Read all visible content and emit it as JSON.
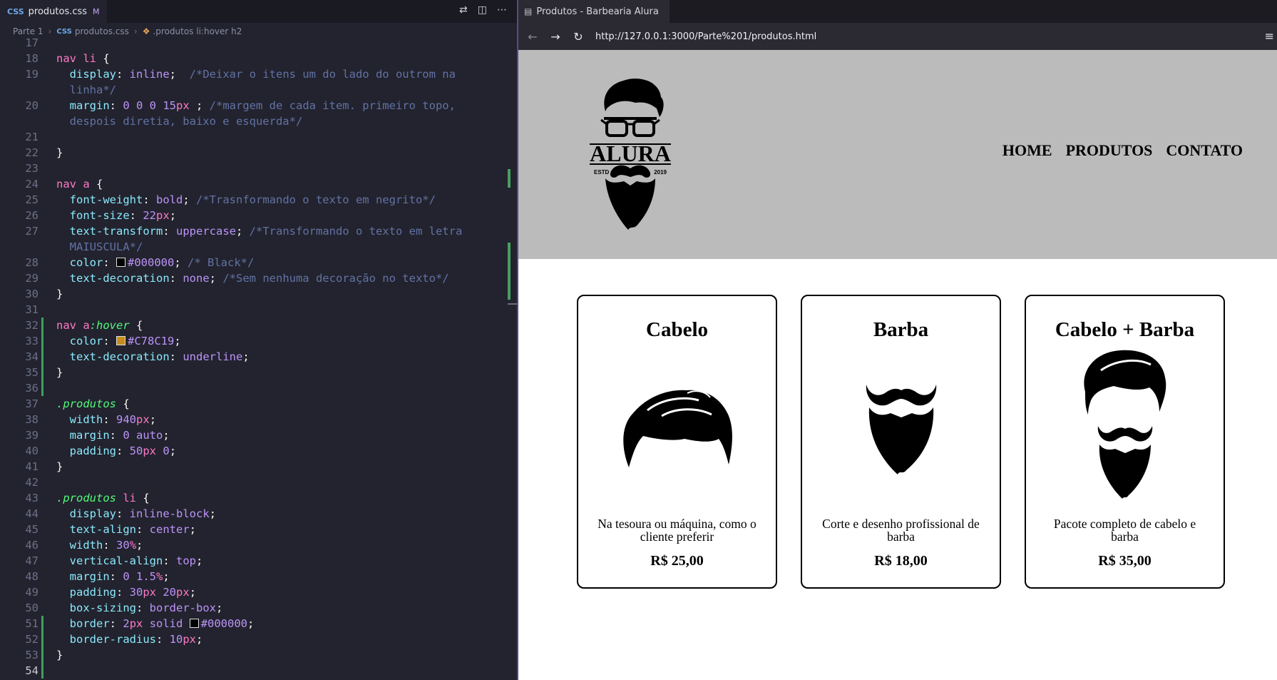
{
  "editor": {
    "tab": {
      "label": "produtos.css",
      "status": "M"
    },
    "breadcrumb": [
      "Parte 1",
      "produtos.css",
      ".produtos li:hover h2"
    ],
    "lines": [
      {
        "n": "17",
        "code": []
      },
      {
        "n": "18",
        "code": [
          [
            "sel",
            "nav li"
          ],
          [
            "p",
            " {"
          ]
        ]
      },
      {
        "n": "19",
        "code": [
          [
            "p",
            "  "
          ],
          [
            "prop",
            "display"
          ],
          [
            "p",
            ": "
          ],
          [
            "val",
            "inline"
          ],
          [
            "p",
            ";  "
          ],
          [
            "com",
            "/*Deixar o itens um do lado do outrom na"
          ]
        ]
      },
      {
        "n": "",
        "code": [
          [
            "p",
            "  "
          ],
          [
            "com",
            "linha*/"
          ]
        ]
      },
      {
        "n": "20",
        "code": [
          [
            "p",
            "  "
          ],
          [
            "prop",
            "margin"
          ],
          [
            "p",
            ": "
          ],
          [
            "num",
            "0 0 0 15"
          ],
          [
            "unit",
            "px"
          ],
          [
            "p",
            " ; "
          ],
          [
            "com",
            "/*margem de cada item. primeiro topo,"
          ]
        ]
      },
      {
        "n": "",
        "code": [
          [
            "p",
            "  "
          ],
          [
            "com",
            "despois diretia, baixo e esquerda*/"
          ]
        ]
      },
      {
        "n": "21",
        "code": []
      },
      {
        "n": "22",
        "code": [
          [
            "p",
            "}"
          ]
        ]
      },
      {
        "n": "23",
        "code": []
      },
      {
        "n": "24",
        "code": [
          [
            "sel",
            "nav a"
          ],
          [
            "p",
            " {"
          ]
        ]
      },
      {
        "n": "25",
        "code": [
          [
            "p",
            "  "
          ],
          [
            "prop",
            "font-weight"
          ],
          [
            "p",
            ": "
          ],
          [
            "val",
            "bold"
          ],
          [
            "p",
            "; "
          ],
          [
            "com",
            "/*Trasnformando o texto em negrito*/"
          ]
        ]
      },
      {
        "n": "26",
        "code": [
          [
            "p",
            "  "
          ],
          [
            "prop",
            "font-size"
          ],
          [
            "p",
            ": "
          ],
          [
            "num",
            "22"
          ],
          [
            "unit",
            "px"
          ],
          [
            "p",
            ";"
          ]
        ]
      },
      {
        "n": "27",
        "code": [
          [
            "p",
            "  "
          ],
          [
            "prop",
            "text-transform"
          ],
          [
            "p",
            ": "
          ],
          [
            "val",
            "uppercase"
          ],
          [
            "p",
            "; "
          ],
          [
            "com",
            "/*Transformando o texto em letra"
          ]
        ]
      },
      {
        "n": "",
        "code": [
          [
            "p",
            "  "
          ],
          [
            "com",
            "MAIUSCULA*/"
          ]
        ]
      },
      {
        "n": "28",
        "code": [
          [
            "p",
            "  "
          ],
          [
            "prop",
            "color"
          ],
          [
            "p",
            ": "
          ],
          [
            "swatch",
            "#000000"
          ],
          [
            "val",
            "#000000"
          ],
          [
            "p",
            "; "
          ],
          [
            "com",
            "/* Black*/"
          ]
        ]
      },
      {
        "n": "29",
        "code": [
          [
            "p",
            "  "
          ],
          [
            "prop",
            "text-decoration"
          ],
          [
            "p",
            ": "
          ],
          [
            "val",
            "none"
          ],
          [
            "p",
            "; "
          ],
          [
            "com",
            "/*Sem nenhuma decoração no texto*/"
          ]
        ]
      },
      {
        "n": "30",
        "code": [
          [
            "p",
            "}"
          ]
        ]
      },
      {
        "n": "31",
        "code": []
      },
      {
        "n": "32",
        "code": [
          [
            "sel",
            "nav a"
          ],
          [
            "pseudo",
            ":hover"
          ],
          [
            "p",
            " {"
          ]
        ]
      },
      {
        "n": "33",
        "code": [
          [
            "p",
            "  "
          ],
          [
            "prop",
            "color"
          ],
          [
            "p",
            ": "
          ],
          [
            "swatch",
            "#C78C19"
          ],
          [
            "val",
            "#C78C19"
          ],
          [
            "p",
            ";"
          ]
        ]
      },
      {
        "n": "34",
        "code": [
          [
            "p",
            "  "
          ],
          [
            "prop",
            "text-decoration"
          ],
          [
            "p",
            ": "
          ],
          [
            "val",
            "underline"
          ],
          [
            "p",
            ";"
          ]
        ]
      },
      {
        "n": "35",
        "code": [
          [
            "p",
            "}"
          ]
        ]
      },
      {
        "n": "36",
        "code": []
      },
      {
        "n": "37",
        "code": [
          [
            "cls",
            ".produtos"
          ],
          [
            "p",
            " {"
          ]
        ]
      },
      {
        "n": "38",
        "code": [
          [
            "p",
            "  "
          ],
          [
            "prop",
            "width"
          ],
          [
            "p",
            ": "
          ],
          [
            "num",
            "940"
          ],
          [
            "unit",
            "px"
          ],
          [
            "p",
            ";"
          ]
        ]
      },
      {
        "n": "39",
        "code": [
          [
            "p",
            "  "
          ],
          [
            "prop",
            "margin"
          ],
          [
            "p",
            ": "
          ],
          [
            "num",
            "0 "
          ],
          [
            "val",
            "auto"
          ],
          [
            "p",
            ";"
          ]
        ]
      },
      {
        "n": "40",
        "code": [
          [
            "p",
            "  "
          ],
          [
            "prop",
            "padding"
          ],
          [
            "p",
            ": "
          ],
          [
            "num",
            "50"
          ],
          [
            "unit",
            "px"
          ],
          [
            "num",
            " 0"
          ],
          [
            "p",
            ";"
          ]
        ]
      },
      {
        "n": "41",
        "code": [
          [
            "p",
            "}"
          ]
        ]
      },
      {
        "n": "42",
        "code": []
      },
      {
        "n": "43",
        "code": [
          [
            "cls",
            ".produtos"
          ],
          [
            "p",
            " "
          ],
          [
            "sel",
            "li"
          ],
          [
            "p",
            " {"
          ]
        ]
      },
      {
        "n": "44",
        "code": [
          [
            "p",
            "  "
          ],
          [
            "prop",
            "display"
          ],
          [
            "p",
            ": "
          ],
          [
            "val",
            "inline-block"
          ],
          [
            "p",
            ";"
          ]
        ]
      },
      {
        "n": "45",
        "code": [
          [
            "p",
            "  "
          ],
          [
            "prop",
            "text-align"
          ],
          [
            "p",
            ": "
          ],
          [
            "val",
            "center"
          ],
          [
            "p",
            ";"
          ]
        ]
      },
      {
        "n": "46",
        "code": [
          [
            "p",
            "  "
          ],
          [
            "prop",
            "width"
          ],
          [
            "p",
            ": "
          ],
          [
            "num",
            "30"
          ],
          [
            "unit",
            "%"
          ],
          [
            "p",
            ";"
          ]
        ]
      },
      {
        "n": "47",
        "code": [
          [
            "p",
            "  "
          ],
          [
            "prop",
            "vertical-align"
          ],
          [
            "p",
            ": "
          ],
          [
            "val",
            "top"
          ],
          [
            "p",
            ";"
          ]
        ]
      },
      {
        "n": "48",
        "code": [
          [
            "p",
            "  "
          ],
          [
            "prop",
            "margin"
          ],
          [
            "p",
            ": "
          ],
          [
            "num",
            "0 1.5"
          ],
          [
            "unit",
            "%"
          ],
          [
            "p",
            ";"
          ]
        ]
      },
      {
        "n": "49",
        "code": [
          [
            "p",
            "  "
          ],
          [
            "prop",
            "padding"
          ],
          [
            "p",
            ": "
          ],
          [
            "num",
            "30"
          ],
          [
            "unit",
            "px"
          ],
          [
            "num",
            " 20"
          ],
          [
            "unit",
            "px"
          ],
          [
            "p",
            ";"
          ]
        ]
      },
      {
        "n": "50",
        "code": [
          [
            "p",
            "  "
          ],
          [
            "prop",
            "box-sizing"
          ],
          [
            "p",
            ": "
          ],
          [
            "val",
            "border-box"
          ],
          [
            "p",
            ";"
          ]
        ]
      },
      {
        "n": "51",
        "code": [
          [
            "p",
            "  "
          ],
          [
            "prop",
            "border"
          ],
          [
            "p",
            ": "
          ],
          [
            "num",
            "2"
          ],
          [
            "unit",
            "px"
          ],
          [
            "val",
            " solid "
          ],
          [
            "swatch",
            "#000000"
          ],
          [
            "val",
            "#000000"
          ],
          [
            "p",
            ";"
          ]
        ]
      },
      {
        "n": "52",
        "code": [
          [
            "p",
            "  "
          ],
          [
            "prop",
            "border-radius"
          ],
          [
            "p",
            ": "
          ],
          [
            "num",
            "10"
          ],
          [
            "unit",
            "px"
          ],
          [
            "p",
            ";"
          ]
        ]
      },
      {
        "n": "53",
        "code": [
          [
            "p",
            "}"
          ]
        ]
      },
      {
        "n": "54",
        "code": []
      }
    ]
  },
  "browser": {
    "tab_title": "Produtos - Barbearia Alura",
    "url": "http://127.0.0.1:3000/Parte%201/produtos.html",
    "logo": {
      "word": "ALURA",
      "left_text": "ESTD",
      "right_text": "2019"
    },
    "nav": [
      "HOME",
      "PRODUTOS",
      "CONTATO"
    ],
    "products": [
      {
        "title": "Cabelo",
        "desc": "Na tesoura ou máquina, como o cliente preferir",
        "price": "R$ 25,00",
        "icon": "hair-icon"
      },
      {
        "title": "Barba",
        "desc": "Corte e desenho profissional de barba",
        "price": "R$ 18,00",
        "icon": "beard-icon"
      },
      {
        "title": "Cabelo + Barba",
        "desc": "Pacote completo de cabelo e barba",
        "price": "R$ 35,00",
        "icon": "hair-and-beard-icon"
      }
    ]
  },
  "colors": {
    "header_gray": "#bbbbbb",
    "hover": "#C78C19",
    "editor_bg": "#22232e"
  }
}
